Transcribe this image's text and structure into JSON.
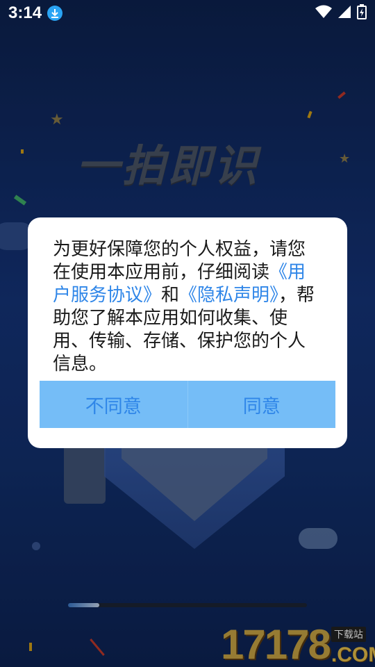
{
  "status_bar": {
    "time": "3:14"
  },
  "background": {
    "app_logo_text": "一拍即识",
    "progress_fraction": 0.13,
    "watermark": {
      "number": "17178",
      "tag": "下载站",
      "domain": ".COM"
    }
  },
  "dialog": {
    "text_intro": "为更好保障您的个人权益，请您在使用本应用前，仔细阅读",
    "link_user_agreement": "《用户服务协议》",
    "text_and": "和",
    "link_privacy": "《隐私声明》",
    "text_outro": "，帮助您了解本应用如何收集、使用、传输、存储、保护您的个人信息。",
    "disagree_label": "不同意",
    "agree_label": "同意"
  },
  "colors": {
    "link": "#2f86e8",
    "button_bar": "#75bdf7",
    "background_top": "#0d2250"
  }
}
